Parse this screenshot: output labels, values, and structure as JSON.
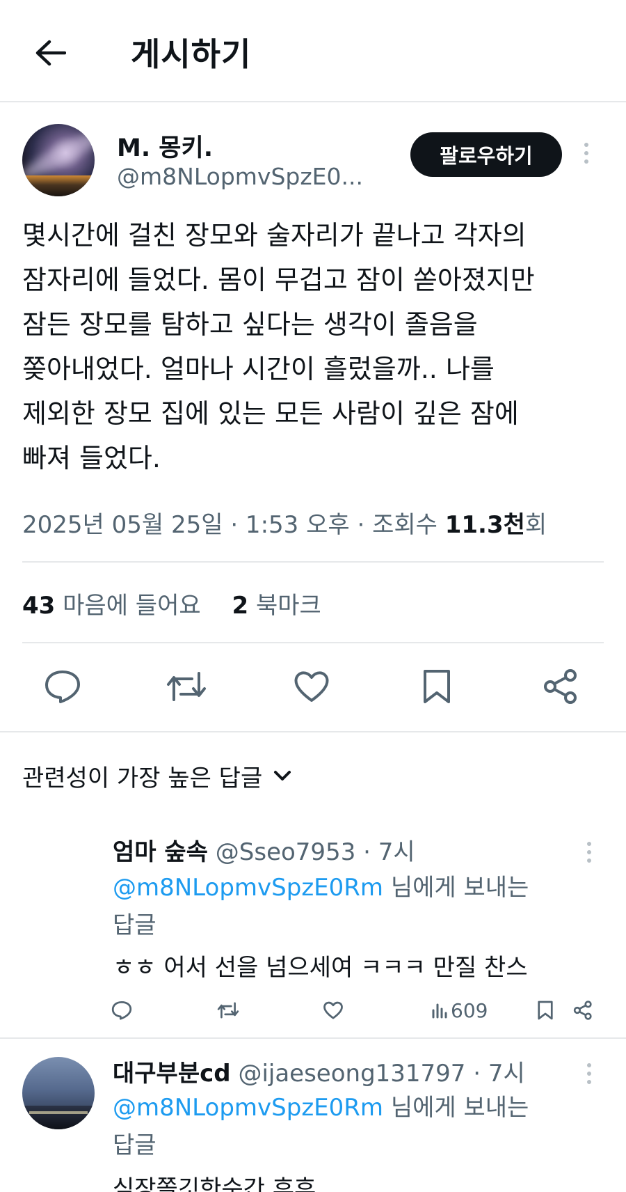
{
  "header": {
    "title": "게시하기"
  },
  "post": {
    "author_name": "M. 몽키.",
    "author_handle": "@m8NLopmvSpzE0...",
    "follow_label": "팔로우하기",
    "lines": [
      "몇시간에 걸친 장모와 술자리가 끝나고 각자의",
      "잠자리에 들었다. 몸이 무겁고 잠이 쏟아졌지만",
      "잠든 장모를 탐하고 싶다는 생각이 졸음을",
      "쫒아내었다. 얼마나 시간이 흘렀을까.. 나를",
      "제외한 장모 집에 있는 모든 사람이 깊은 잠에",
      "빠져 들었다."
    ],
    "meta_prefix": "2025년 05월 25일 · 1:53 오후 · 조회수 ",
    "views": "11.3천",
    "views_suffix": "회",
    "likes_count": "43",
    "likes_label": "마음에 들어요",
    "bookmarks_count": "2",
    "bookmarks_label": "북마크"
  },
  "actions": [
    "reply-icon",
    "repost-icon",
    "like-icon",
    "bookmark-icon",
    "share-icon"
  ],
  "replies_sort": {
    "label": "관련성이 가장 높은 답글"
  },
  "replies": [
    {
      "name": "엄마 숲속",
      "handle_time": "@Sseo7953 · 7시",
      "mention": "@m8NLopmvSpzE0Rm",
      "reply_to_suffix": " 님에게 보내는",
      "reply_to_line2": "답글",
      "text": "ㅎㅎ 어서 선을 넘으세여  ㅋㅋㅋ 만질 찬스",
      "views": "609"
    },
    {
      "name": "대구부분cd",
      "handle_time": "@ijaeseong131797 · 7시",
      "mention": "@m8NLopmvSpzE0Rm",
      "reply_to_suffix": " 님에게 보내는",
      "reply_to_line2": "답글",
      "text": "심장쫄깃한순간 후후"
    }
  ],
  "colors": {
    "accent": "#1d9bf0",
    "text": "#0f1419",
    "muted": "#536471",
    "divider": "#e6e8ea"
  }
}
